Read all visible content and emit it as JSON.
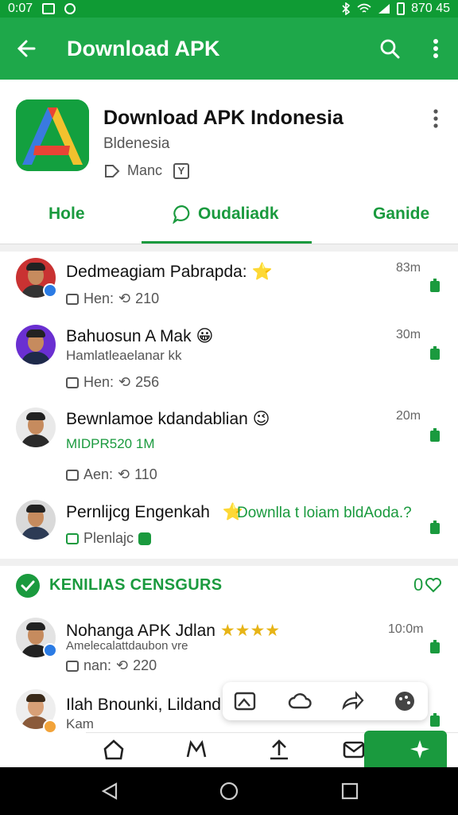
{
  "status_bar": {
    "time": "0:07",
    "right_text": "870 45"
  },
  "app_bar": {
    "title": "Download APK",
    "back_icon": "arrow-left-icon",
    "search_icon": "search-icon",
    "more_icon": "more-vert-icon"
  },
  "app_header": {
    "name": "Download APK Indonesia",
    "subtitle": "Bldenesia",
    "meta_label": "Manc",
    "meta_badge": "Y"
  },
  "tabs": [
    {
      "label": "Hole",
      "active": false
    },
    {
      "label": "Oudaliadk",
      "active": true,
      "icon": "chat-bubble-icon"
    },
    {
      "label": "Ganide",
      "active": false
    }
  ],
  "rows": [
    {
      "name": "Dedmeagiam Pabrapda:",
      "emoji": "⭐",
      "sub": "",
      "meta_left": "Hen:",
      "meta_count": "210",
      "time": "83m"
    },
    {
      "name": "Bahuosun A Mak",
      "emoji": "😀",
      "sub": "Hamlatleaelanar kk",
      "meta_left": "Hen:",
      "meta_count": "256",
      "time": "30m"
    },
    {
      "name": "Bewnlamoe kdandablian",
      "emoji": "😉",
      "sub": "MIDPR520 1M",
      "meta_left": "Aen:",
      "meta_count": "110",
      "time": "20m"
    },
    {
      "name": "Pernlijcg Engenkah",
      "emoji": "⭐",
      "sub": "Plenlajc",
      "meta_left": "",
      "meta_count": "",
      "time": "",
      "link": "Downlla t loiam bldAoda.?"
    }
  ],
  "section": {
    "title": "KENILIAS CENSGURS",
    "count": "0"
  },
  "rows2": [
    {
      "name": "Nohanga APK",
      "mid": "Jdlan",
      "stars": "★★★★",
      "sub": "Amelecalattdaubon vre",
      "meta_left": "nan:",
      "meta_count": "220",
      "time": "10:0m"
    },
    {
      "name": "Ilah Bnounki, Lildand",
      "sub": "Kam",
      "meta_left": "",
      "meta_count": "",
      "time": ""
    }
  ],
  "colors": {
    "brand_green": "#1ea84a",
    "status_green": "#0f9b34",
    "accent_green": "#1a9a3e"
  }
}
